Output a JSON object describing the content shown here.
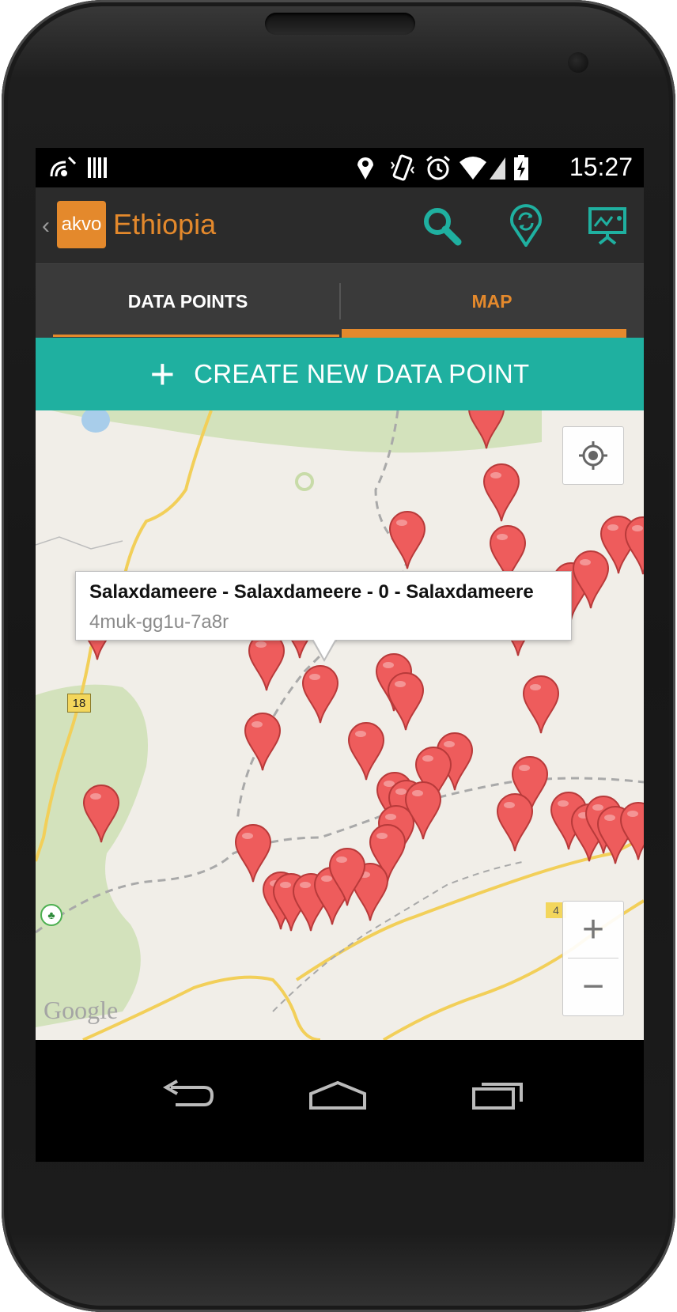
{
  "status_bar": {
    "time": "15:27",
    "icons": [
      "nfc-icon",
      "barcode-icon",
      "location-pin-icon",
      "vibrate-icon",
      "alarm-icon",
      "wifi-icon",
      "signal-icon",
      "battery-charging-icon"
    ]
  },
  "action_bar": {
    "logo_text": "akvo",
    "title": "Ethiopia",
    "actions": [
      "search-icon",
      "sync-location-icon",
      "presentation-icon"
    ]
  },
  "tabs": [
    {
      "label": "DATA POINTS",
      "selected": false
    },
    {
      "label": "MAP",
      "selected": true
    }
  ],
  "create_button": {
    "label": "CREATE NEW DATA POINT"
  },
  "map": {
    "road_labels": [
      "18",
      "4"
    ],
    "attribution": "Google",
    "info_window": {
      "title": "Salaxdameere - Salaxdameere - 0 - Salaxdameere",
      "subtitle": "4muk-gg1u-7a8r"
    },
    "zoom_in": "+",
    "zoom_out": "−"
  },
  "colors": {
    "accent_orange": "#e4892c",
    "teal": "#1fb0a0",
    "marker_red": "#ee5c5c",
    "action_bar": "#2b2b2b"
  }
}
